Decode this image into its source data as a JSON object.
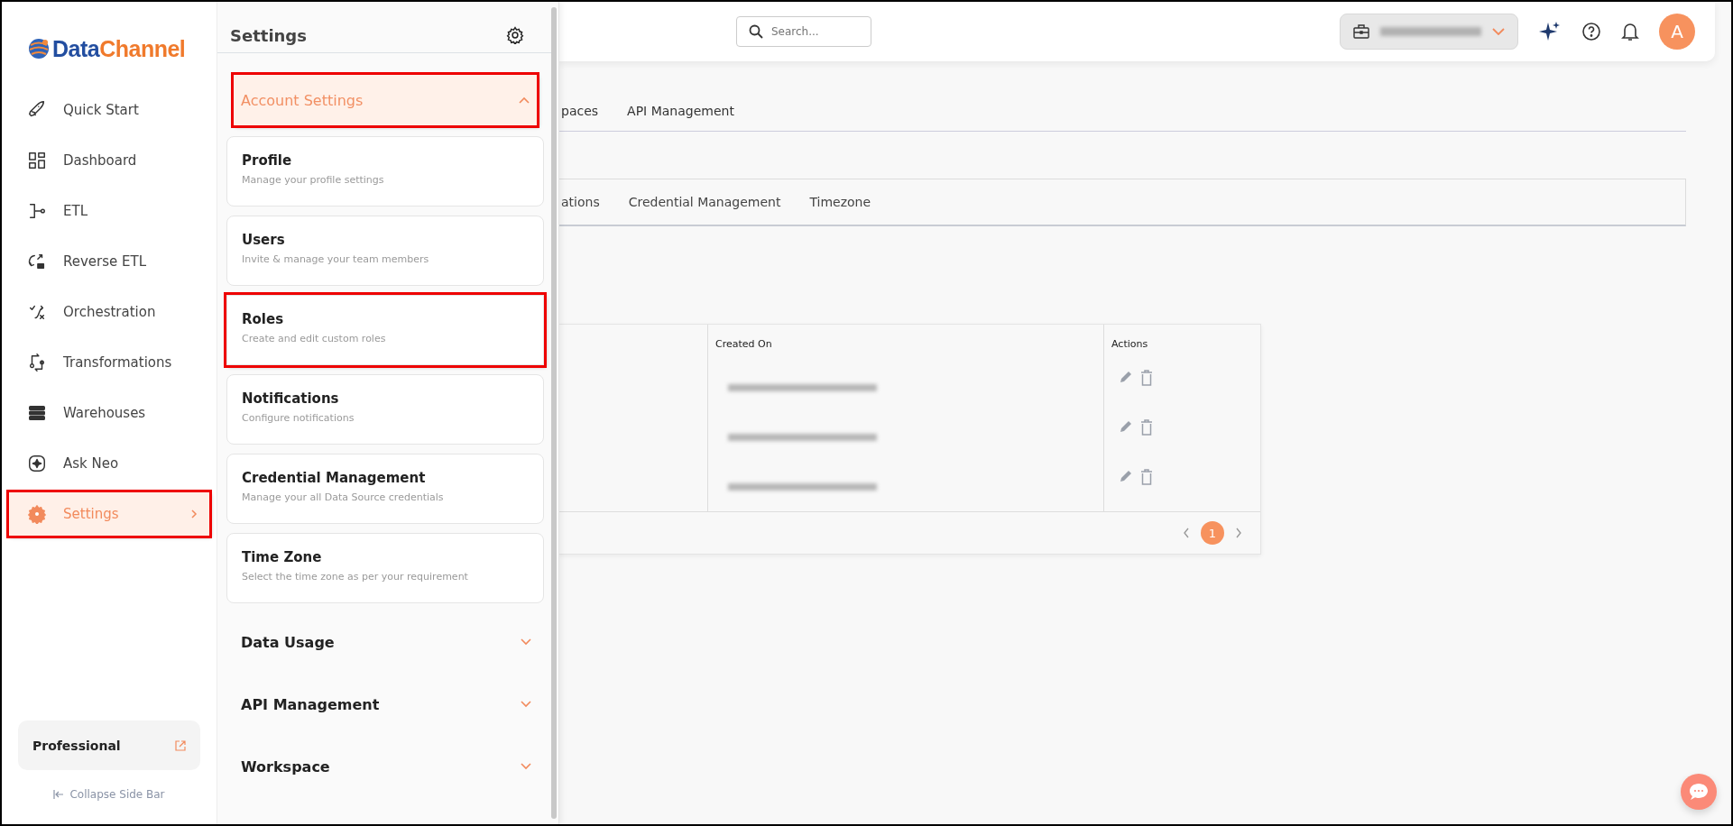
{
  "brand": {
    "part_1": "Data",
    "part_2": "Channel"
  },
  "sidebar": {
    "items": [
      {
        "label": "Quick Start",
        "selected": false,
        "submenu": false,
        "highlighted": false
      },
      {
        "label": "Dashboard",
        "selected": false,
        "submenu": false,
        "highlighted": false
      },
      {
        "label": "ETL",
        "selected": false,
        "submenu": false,
        "highlighted": false
      },
      {
        "label": "Reverse ETL",
        "selected": false,
        "submenu": false,
        "highlighted": false
      },
      {
        "label": "Orchestration",
        "selected": false,
        "submenu": false,
        "highlighted": false
      },
      {
        "label": "Transformations",
        "selected": false,
        "submenu": false,
        "highlighted": false
      },
      {
        "label": "Warehouses",
        "selected": false,
        "submenu": false,
        "highlighted": false
      },
      {
        "label": "Ask Neo",
        "selected": false,
        "submenu": false,
        "highlighted": false
      },
      {
        "label": "Settings",
        "selected": true,
        "submenu": true,
        "highlighted": true
      }
    ],
    "plan": {
      "name": "Professional"
    },
    "collapse_label": "Collapse Side Bar"
  },
  "settings_panel": {
    "title": "Settings",
    "sections": [
      {
        "title": "Account Settings",
        "expanded": true,
        "highlighted": true,
        "items": [
          {
            "title": "Profile",
            "description": "Manage your profile settings",
            "highlighted": false
          },
          {
            "title": "Users",
            "description": "Invite & manage your team members",
            "highlighted": false
          },
          {
            "title": "Roles",
            "description": "Create and edit custom roles",
            "highlighted": true
          },
          {
            "title": "Notifications",
            "description": "Configure notifications",
            "highlighted": false
          },
          {
            "title": "Credential Management",
            "description": "Manage your all Data Source credentials",
            "highlighted": false
          },
          {
            "title": "Time Zone",
            "description": "Select the time zone as per your requirement",
            "highlighted": false
          }
        ]
      },
      {
        "title": "Data Usage",
        "expanded": false,
        "highlighted": false
      },
      {
        "title": "API Management",
        "expanded": false,
        "highlighted": false
      },
      {
        "title": "Workspace",
        "expanded": false,
        "highlighted": false
      }
    ]
  },
  "header": {
    "search": {
      "placeholder": "Search..."
    },
    "avatar": {
      "initial": "A"
    }
  },
  "tabs": [
    {
      "label": "paces",
      "selected": false
    },
    {
      "label": "API Management",
      "selected": false
    }
  ],
  "sub_tabs": [
    {
      "label": "ations",
      "selected": false
    },
    {
      "label": "Credential Management",
      "selected": false
    },
    {
      "label": "Timezone",
      "selected": false
    }
  ],
  "table": {
    "columns": [
      {
        "label": "Created On"
      },
      {
        "label": "Actions"
      }
    ],
    "rows": [
      {
        "redacted": true
      },
      {
        "redacted": true
      },
      {
        "redacted": true
      }
    ],
    "pagination": [
      {
        "label": "1",
        "selected": true
      }
    ]
  }
}
